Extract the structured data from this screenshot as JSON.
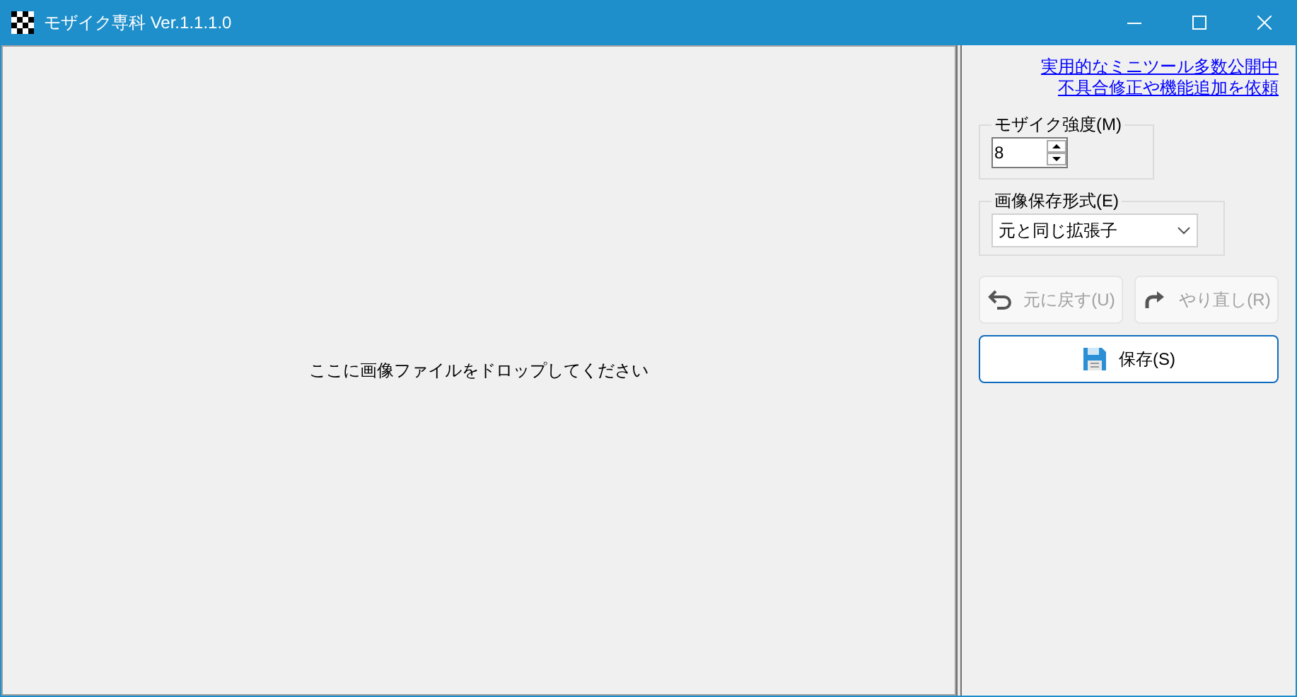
{
  "window": {
    "title": "モザイク専科 Ver.1.1.1.0"
  },
  "drop_area": {
    "message": "ここに画像ファイルをドロップしてください"
  },
  "links": [
    "実用的なミニツール多数公開中",
    "不具合修正や機能追加を依頼"
  ],
  "mosaic_strength": {
    "label": "モザイク強度(M)",
    "value": "8"
  },
  "save_format": {
    "label": "画像保存形式(E)",
    "value": "元と同じ拡張子"
  },
  "buttons": [
    {
      "kind": "undo",
      "label": "元に戻す(U)",
      "disabled": true
    },
    {
      "kind": "redo",
      "label": "やり直し(R)",
      "disabled": true
    },
    {
      "kind": "save",
      "label": "保存(S)",
      "disabled": false
    }
  ]
}
